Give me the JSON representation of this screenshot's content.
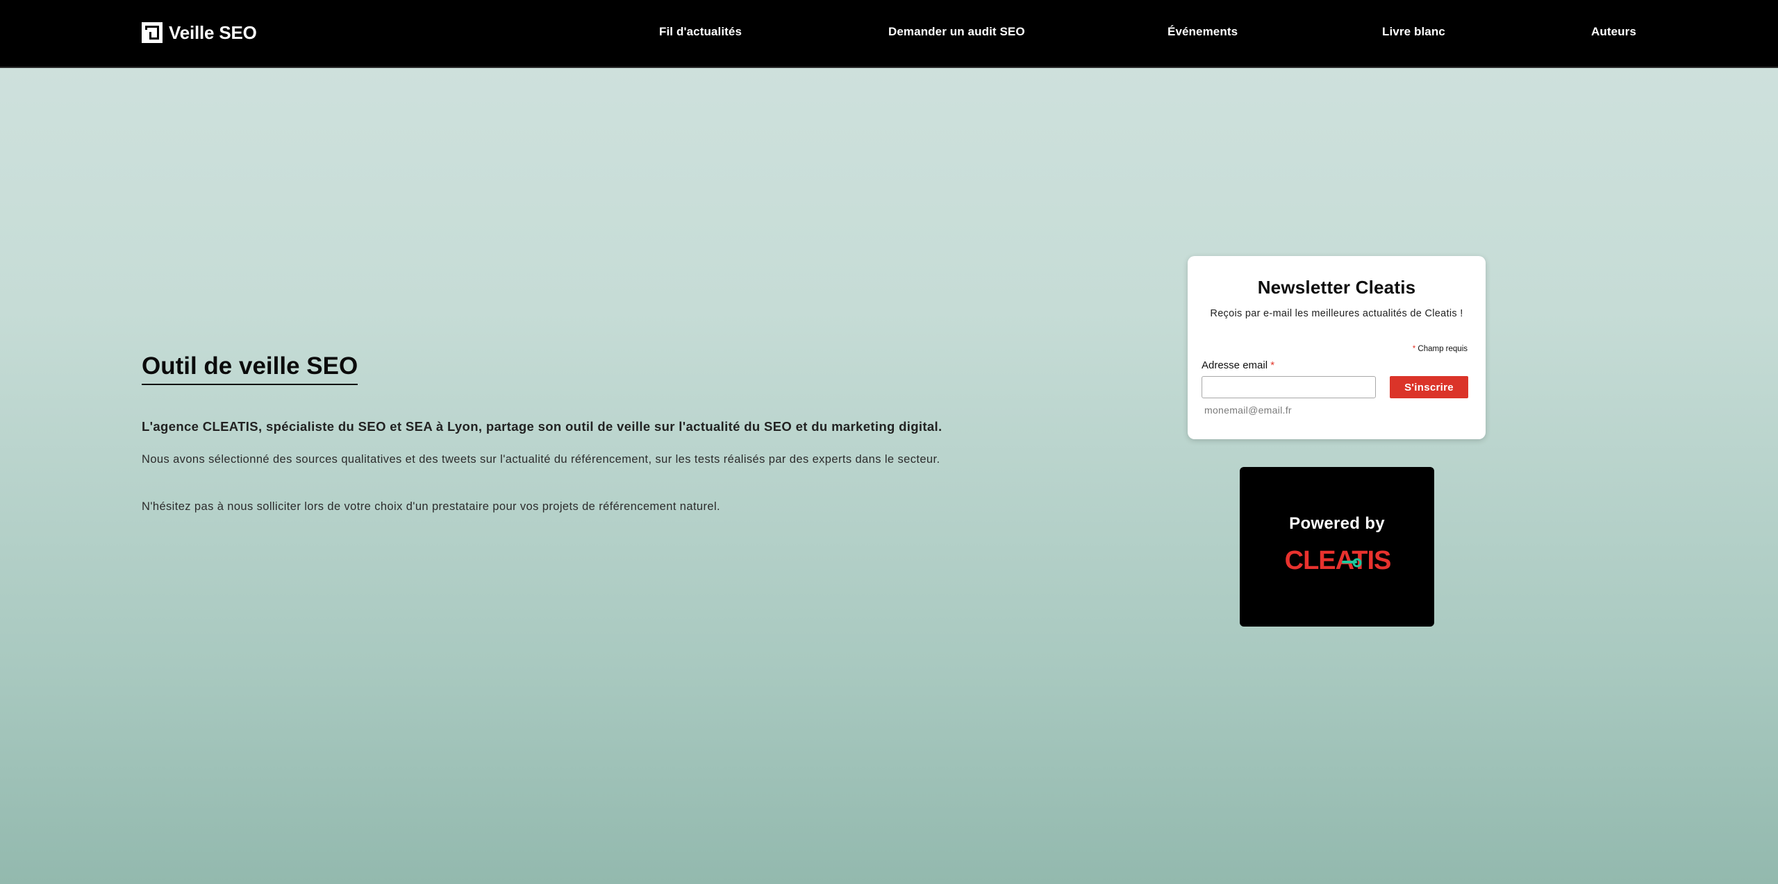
{
  "header": {
    "brand": "Veille SEO",
    "nav": [
      {
        "label": "Fil d'actualités"
      },
      {
        "label": "Demander un audit SEO"
      },
      {
        "label": "Événements"
      },
      {
        "label": "Livre blanc"
      },
      {
        "label": "Auteurs"
      }
    ]
  },
  "main": {
    "title": "Outil de veille SEO",
    "lead": "L'agence CLEATIS, spécialiste du SEO et SEA à Lyon, partage son outil de veille sur l'actualité du SEO et du marketing digital.",
    "paragraphs": [
      "Nous avons sélectionné des sources qualitatives et des tweets sur l'actualité du référencement, sur les tests réalisés par des experts dans le secteur.",
      "N'hésitez pas à nous solliciter lors de votre choix d'un prestataire pour vos projets de référencement naturel."
    ]
  },
  "newsletter": {
    "title": "Newsletter Cleatis",
    "description": "Reçois par e-mail les meilleures actualités de Cleatis !",
    "required_mark": "*",
    "required_note": "Champ requis",
    "email_label": "Adresse email",
    "email_value": "",
    "email_hint": "monemail@email.fr",
    "submit_label": "S'inscrire"
  },
  "powered": {
    "text": "Powered by",
    "logo_text": "CLEATIS"
  },
  "colors": {
    "accent_red": "#db3429",
    "logo_red": "#e8322e",
    "logo_green": "#1fc79c",
    "header_bg": "#000000"
  },
  "icons": {
    "brand": "square-frame-icon"
  }
}
